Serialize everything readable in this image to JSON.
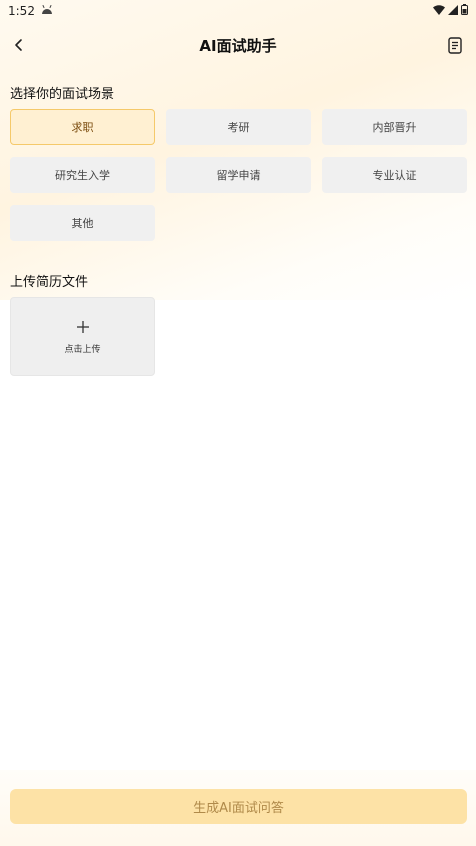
{
  "status_bar": {
    "time": "1:52"
  },
  "header": {
    "title": "AI面试助手"
  },
  "scene_section": {
    "title": "选择你的面试场景",
    "options": [
      {
        "label": "求职",
        "selected": true
      },
      {
        "label": "考研",
        "selected": false
      },
      {
        "label": "内部晋升",
        "selected": false
      },
      {
        "label": "研究生入学",
        "selected": false
      },
      {
        "label": "留学申请",
        "selected": false
      },
      {
        "label": "专业认证",
        "selected": false
      },
      {
        "label": "其他",
        "selected": false
      }
    ]
  },
  "upload_section": {
    "title": "上传简历文件",
    "upload_label": "点击上传"
  },
  "footer": {
    "generate_label": "生成AI面试问答"
  },
  "colors": {
    "accent": "#fde2a6",
    "selected_bg": "#fff0d2",
    "selected_border": "#f5c96a"
  }
}
